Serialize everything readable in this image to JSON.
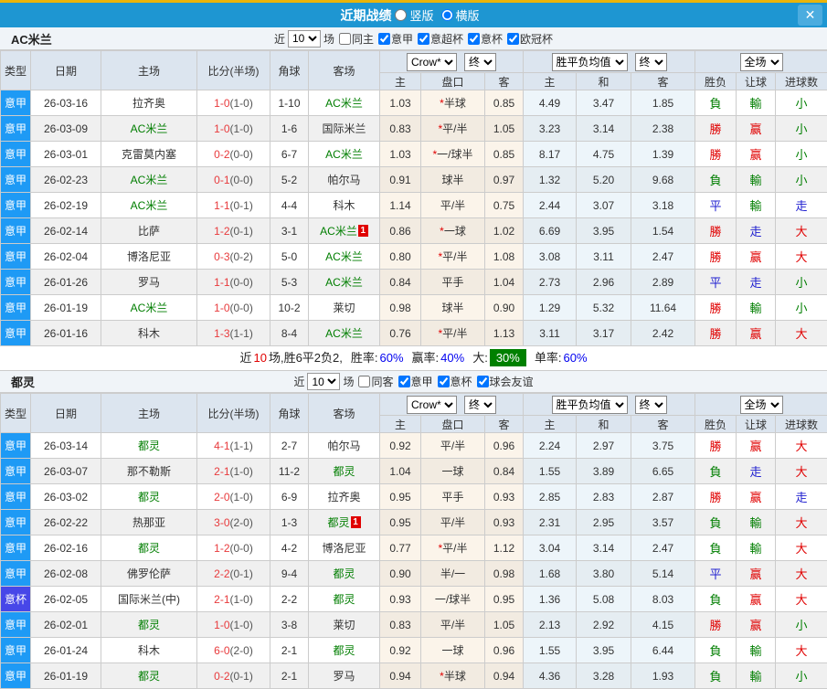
{
  "titlebar": {
    "title": "近期战绩",
    "vertical": "竖版",
    "horizontal": "横版",
    "selected": "横版",
    "close": "✕"
  },
  "columns": {
    "main": [
      "类型",
      "日期",
      "主场",
      "比分(半场)",
      "角球",
      "客场"
    ],
    "sub": [
      "主",
      "盘口",
      "客",
      "主",
      "和",
      "客",
      "胜负",
      "让球",
      "进球数"
    ],
    "selects": {
      "company": "Crow*",
      "final": "终",
      "mean": "胜平负均值",
      "scope": "全场"
    }
  },
  "colors": {
    "league": {
      "意甲": "#1e9af5",
      "意杯": "#4747e8"
    },
    "focal_team": "#007e00",
    "score": "#e83a3c",
    "score_half": "#555555",
    "star": "#e00000",
    "badge_bg": "#e00000",
    "result": {
      "勝": "#e00000",
      "赢": "#e00000",
      "大": "#e00000",
      "負": "#007e00",
      "輸": "#007e00",
      "小": "#007e00",
      "平": "#2020d0",
      "走": "#2020d0"
    },
    "titlebar_bg": "#1e96d2",
    "topline": "#eab40a",
    "percent": "#0000f0",
    "big_badge_bg": "#008000"
  },
  "sections": [
    {
      "team": "AC米兰",
      "filter": {
        "near": "近",
        "count": "10",
        "games": "场",
        "same": "同主",
        "same_checked": false,
        "leagues": [
          {
            "label": "意甲",
            "checked": true
          },
          {
            "label": "意超杯",
            "checked": true
          },
          {
            "label": "意杯",
            "checked": true
          },
          {
            "label": "欧冠杯",
            "checked": true
          }
        ]
      },
      "rows": [
        {
          "lg": "意甲",
          "date": "26-03-16",
          "home": "拉齐奥",
          "hf": false,
          "score": "1-0",
          "half": "(1-0)",
          "corner": "1-10",
          "away": "AC米兰",
          "af": true,
          "badge": "",
          "h1": "1.03",
          "star": true,
          "pan": "半球",
          "h2": "0.85",
          "m1": "4.49",
          "m2": "3.47",
          "m3": "1.85",
          "res": "負",
          "let": "輸",
          "goal": "小"
        },
        {
          "lg": "意甲",
          "date": "26-03-09",
          "home": "AC米兰",
          "hf": true,
          "score": "1-0",
          "half": "(1-0)",
          "corner": "1-6",
          "away": "国际米兰",
          "af": false,
          "badge": "",
          "h1": "0.83",
          "star": true,
          "pan": "平/半",
          "h2": "1.05",
          "m1": "3.23",
          "m2": "3.14",
          "m3": "2.38",
          "res": "勝",
          "let": "赢",
          "goal": "小"
        },
        {
          "lg": "意甲",
          "date": "26-03-01",
          "home": "克雷莫内塞",
          "hf": false,
          "score": "0-2",
          "half": "(0-0)",
          "corner": "6-7",
          "away": "AC米兰",
          "af": true,
          "badge": "",
          "h1": "1.03",
          "star": true,
          "pan": "一/球半",
          "h2": "0.85",
          "m1": "8.17",
          "m2": "4.75",
          "m3": "1.39",
          "res": "勝",
          "let": "赢",
          "goal": "小"
        },
        {
          "lg": "意甲",
          "date": "26-02-23",
          "home": "AC米兰",
          "hf": true,
          "score": "0-1",
          "half": "(0-0)",
          "corner": "5-2",
          "away": "帕尔马",
          "af": false,
          "badge": "",
          "h1": "0.91",
          "star": false,
          "pan": "球半",
          "h2": "0.97",
          "m1": "1.32",
          "m2": "5.20",
          "m3": "9.68",
          "res": "負",
          "let": "輸",
          "goal": "小"
        },
        {
          "lg": "意甲",
          "date": "26-02-19",
          "home": "AC米兰",
          "hf": true,
          "score": "1-1",
          "half": "(0-1)",
          "corner": "4-4",
          "away": "科木",
          "af": false,
          "badge": "",
          "h1": "1.14",
          "star": false,
          "pan": "平/半",
          "h2": "0.75",
          "m1": "2.44",
          "m2": "3.07",
          "m3": "3.18",
          "res": "平",
          "let": "輸",
          "goal": "走"
        },
        {
          "lg": "意甲",
          "date": "26-02-14",
          "home": "比萨",
          "hf": false,
          "score": "1-2",
          "half": "(0-1)",
          "corner": "3-1",
          "away": "AC米兰",
          "af": true,
          "badge": "1",
          "h1": "0.86",
          "star": true,
          "pan": "一球",
          "h2": "1.02",
          "m1": "6.69",
          "m2": "3.95",
          "m3": "1.54",
          "res": "勝",
          "let": "走",
          "goal": "大"
        },
        {
          "lg": "意甲",
          "date": "26-02-04",
          "home": "博洛尼亚",
          "hf": false,
          "score": "0-3",
          "half": "(0-2)",
          "corner": "5-0",
          "away": "AC米兰",
          "af": true,
          "badge": "",
          "h1": "0.80",
          "star": true,
          "pan": "平/半",
          "h2": "1.08",
          "m1": "3.08",
          "m2": "3.11",
          "m3": "2.47",
          "res": "勝",
          "let": "赢",
          "goal": "大"
        },
        {
          "lg": "意甲",
          "date": "26-01-26",
          "home": "罗马",
          "hf": false,
          "score": "1-1",
          "half": "(0-0)",
          "corner": "5-3",
          "away": "AC米兰",
          "af": true,
          "badge": "",
          "h1": "0.84",
          "star": false,
          "pan": "平手",
          "h2": "1.04",
          "m1": "2.73",
          "m2": "2.96",
          "m3": "2.89",
          "res": "平",
          "let": "走",
          "goal": "小"
        },
        {
          "lg": "意甲",
          "date": "26-01-19",
          "home": "AC米兰",
          "hf": true,
          "score": "1-0",
          "half": "(0-0)",
          "corner": "10-2",
          "away": "莱切",
          "af": false,
          "badge": "",
          "h1": "0.98",
          "star": false,
          "pan": "球半",
          "h2": "0.90",
          "m1": "1.29",
          "m2": "5.32",
          "m3": "11.64",
          "res": "勝",
          "let": "輸",
          "goal": "小"
        },
        {
          "lg": "意甲",
          "date": "26-01-16",
          "home": "科木",
          "hf": false,
          "score": "1-3",
          "half": "(1-1)",
          "corner": "8-4",
          "away": "AC米兰",
          "af": true,
          "badge": "",
          "h1": "0.76",
          "star": true,
          "pan": "平/半",
          "h2": "1.13",
          "m1": "3.11",
          "m2": "3.17",
          "m3": "2.42",
          "res": "勝",
          "let": "赢",
          "goal": "大"
        }
      ],
      "summary": {
        "prefix": "近",
        "count": "10",
        "mid": "场,胜6平2负2,",
        "win_label": "胜率:",
        "win": "60%",
        "handicap_label": "赢率:",
        "handicap": "40%",
        "big_label": "大:",
        "big": "30%",
        "single_label": "单率:",
        "single": "60%"
      }
    },
    {
      "team": "都灵",
      "filter": {
        "near": "近",
        "count": "10",
        "games": "场",
        "same": "同客",
        "same_checked": false,
        "leagues": [
          {
            "label": "意甲",
            "checked": true
          },
          {
            "label": "意杯",
            "checked": true
          },
          {
            "label": "球会友谊",
            "checked": true
          }
        ]
      },
      "rows": [
        {
          "lg": "意甲",
          "date": "26-03-14",
          "home": "都灵",
          "hf": true,
          "score": "4-1",
          "half": "(1-1)",
          "corner": "2-7",
          "away": "帕尔马",
          "af": false,
          "badge": "",
          "h1": "0.92",
          "star": false,
          "pan": "平/半",
          "h2": "0.96",
          "m1": "2.24",
          "m2": "2.97",
          "m3": "3.75",
          "res": "勝",
          "let": "赢",
          "goal": "大"
        },
        {
          "lg": "意甲",
          "date": "26-03-07",
          "home": "那不勒斯",
          "hf": false,
          "score": "2-1",
          "half": "(1-0)",
          "corner": "11-2",
          "away": "都灵",
          "af": true,
          "badge": "",
          "h1": "1.04",
          "star": false,
          "pan": "一球",
          "h2": "0.84",
          "m1": "1.55",
          "m2": "3.89",
          "m3": "6.65",
          "res": "負",
          "let": "走",
          "goal": "大"
        },
        {
          "lg": "意甲",
          "date": "26-03-02",
          "home": "都灵",
          "hf": true,
          "score": "2-0",
          "half": "(1-0)",
          "corner": "6-9",
          "away": "拉齐奥",
          "af": false,
          "badge": "",
          "h1": "0.95",
          "star": false,
          "pan": "平手",
          "h2": "0.93",
          "m1": "2.85",
          "m2": "2.83",
          "m3": "2.87",
          "res": "勝",
          "let": "赢",
          "goal": "走"
        },
        {
          "lg": "意甲",
          "date": "26-02-22",
          "home": "热那亚",
          "hf": false,
          "score": "3-0",
          "half": "(2-0)",
          "corner": "1-3",
          "away": "都灵",
          "af": true,
          "badge": "1",
          "h1": "0.95",
          "star": false,
          "pan": "平/半",
          "h2": "0.93",
          "m1": "2.31",
          "m2": "2.95",
          "m3": "3.57",
          "res": "負",
          "let": "輸",
          "goal": "大"
        },
        {
          "lg": "意甲",
          "date": "26-02-16",
          "home": "都灵",
          "hf": true,
          "score": "1-2",
          "half": "(0-0)",
          "corner": "4-2",
          "away": "博洛尼亚",
          "af": false,
          "badge": "",
          "h1": "0.77",
          "star": true,
          "pan": "平/半",
          "h2": "1.12",
          "m1": "3.04",
          "m2": "3.14",
          "m3": "2.47",
          "res": "負",
          "let": "輸",
          "goal": "大"
        },
        {
          "lg": "意甲",
          "date": "26-02-08",
          "home": "佛罗伦萨",
          "hf": false,
          "score": "2-2",
          "half": "(0-1)",
          "corner": "9-4",
          "away": "都灵",
          "af": true,
          "badge": "",
          "h1": "0.90",
          "star": false,
          "pan": "半/一",
          "h2": "0.98",
          "m1": "1.68",
          "m2": "3.80",
          "m3": "5.14",
          "res": "平",
          "let": "赢",
          "goal": "大"
        },
        {
          "lg": "意杯",
          "date": "26-02-05",
          "home": "国际米兰(中)",
          "hf": false,
          "score": "2-1",
          "half": "(1-0)",
          "corner": "2-2",
          "away": "都灵",
          "af": true,
          "badge": "",
          "h1": "0.93",
          "star": false,
          "pan": "一/球半",
          "h2": "0.95",
          "m1": "1.36",
          "m2": "5.08",
          "m3": "8.03",
          "res": "負",
          "let": "赢",
          "goal": "大"
        },
        {
          "lg": "意甲",
          "date": "26-02-01",
          "home": "都灵",
          "hf": true,
          "score": "1-0",
          "half": "(1-0)",
          "corner": "3-8",
          "away": "莱切",
          "af": false,
          "badge": "",
          "h1": "0.83",
          "star": false,
          "pan": "平/半",
          "h2": "1.05",
          "m1": "2.13",
          "m2": "2.92",
          "m3": "4.15",
          "res": "勝",
          "let": "赢",
          "goal": "小"
        },
        {
          "lg": "意甲",
          "date": "26-01-24",
          "home": "科木",
          "hf": false,
          "score": "6-0",
          "half": "(2-0)",
          "corner": "2-1",
          "away": "都灵",
          "af": true,
          "badge": "",
          "h1": "0.92",
          "star": false,
          "pan": "一球",
          "h2": "0.96",
          "m1": "1.55",
          "m2": "3.95",
          "m3": "6.44",
          "res": "負",
          "let": "輸",
          "goal": "大"
        },
        {
          "lg": "意甲",
          "date": "26-01-19",
          "home": "都灵",
          "hf": true,
          "score": "0-2",
          "half": "(0-1)",
          "corner": "2-1",
          "away": "罗马",
          "af": false,
          "badge": "",
          "h1": "0.94",
          "star": true,
          "pan": "半球",
          "h2": "0.94",
          "m1": "4.36",
          "m2": "3.28",
          "m3": "1.93",
          "res": "負",
          "let": "輸",
          "goal": "小"
        }
      ]
    }
  ]
}
